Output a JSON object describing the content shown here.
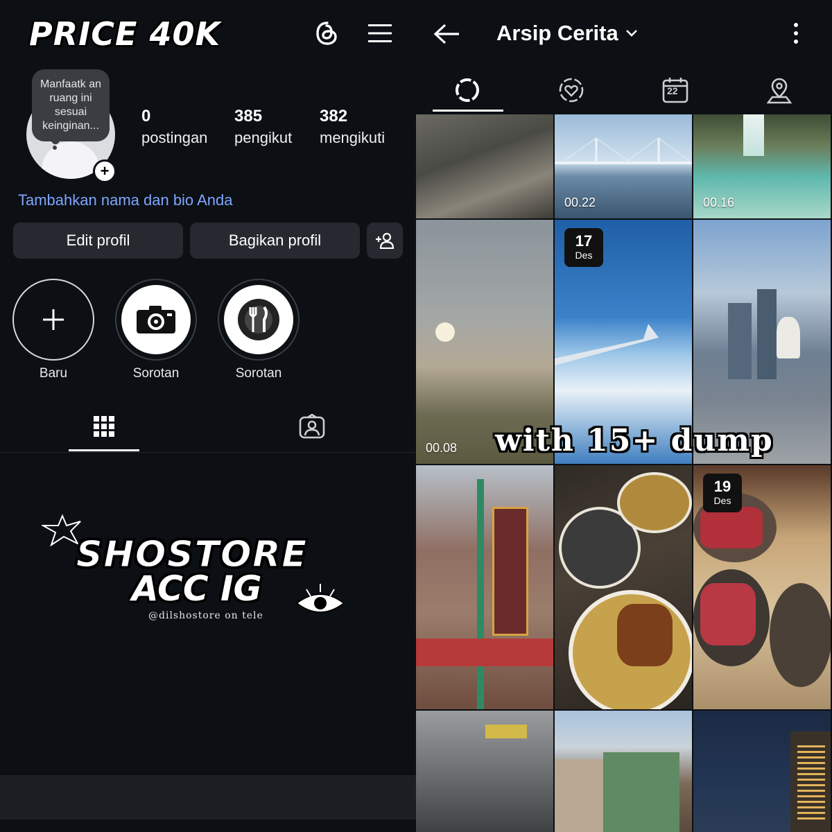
{
  "profile": {
    "banner_text": "PRICE 40K",
    "tooltip": "Manfaatk an ruang ini sesuai keinginan...",
    "stats": [
      {
        "value": "0",
        "label": "postingan"
      },
      {
        "value": "385",
        "label": "pengikut"
      },
      {
        "value": "382",
        "label": "mengikuti"
      }
    ],
    "bio_prompt": "Tambahkan nama dan bio Anda",
    "edit_label": "Edit profil",
    "share_label": "Bagikan profil",
    "highlights": [
      {
        "label": "Baru",
        "icon": "plus-icon"
      },
      {
        "label": "Sorotan",
        "icon": "camera-icon"
      },
      {
        "label": "Sorotan",
        "icon": "cutlery-icon"
      }
    ],
    "watermark_title": "SHOSTORE",
    "watermark_subtitle": "ACC IG",
    "watermark_handle": "@dilshostore on tele"
  },
  "archive": {
    "title": "Arsip Cerita",
    "tabs": [
      "story-archive-icon",
      "favorites-icon",
      "calendar-icon",
      "location-icon"
    ],
    "calendar_day": "22",
    "overlay_text": "with 15+ dump",
    "tiles": [
      {
        "time": "",
        "date_day": "",
        "date_month": ""
      },
      {
        "time": "00.22",
        "date_day": "",
        "date_month": ""
      },
      {
        "time": "00.16",
        "date_day": "",
        "date_month": ""
      },
      {
        "time": "00.08",
        "date_day": "",
        "date_month": ""
      },
      {
        "time": "",
        "date_day": "17",
        "date_month": "Des"
      },
      {
        "time": "",
        "date_day": "",
        "date_month": ""
      },
      {
        "time": "",
        "date_day": "",
        "date_month": ""
      },
      {
        "time": "",
        "date_day": "",
        "date_month": ""
      },
      {
        "time": "",
        "date_day": "19",
        "date_month": "Des"
      },
      {
        "time": "",
        "date_day": "",
        "date_month": ""
      },
      {
        "time": "",
        "date_day": "",
        "date_month": ""
      },
      {
        "time": "",
        "date_day": "",
        "date_month": ""
      }
    ]
  },
  "colors": {
    "background": "#0c0f14",
    "button": "#26292f",
    "link": "#7fa6ff"
  }
}
